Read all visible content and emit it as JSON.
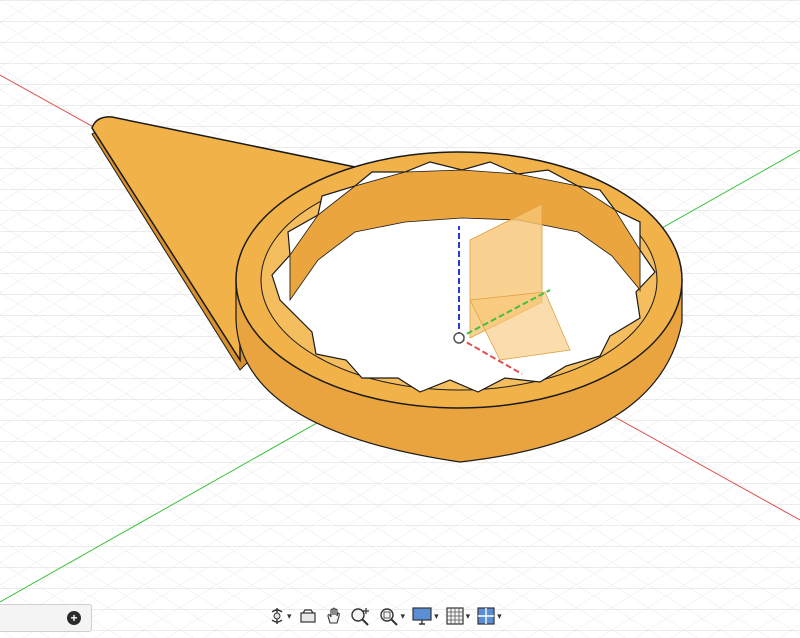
{
  "viewport": {
    "background": "#ffffff",
    "grid_color": "#d9d9d9",
    "model_color": "#f2b24a",
    "model_shadow_color": "#d8902c",
    "axis_x_color": "#e05050",
    "axis_y_color": "#3ec23e",
    "axis_z_color": "#2a3ccf"
  },
  "browser_panel": {
    "expand_icon": "plus-circle-icon"
  },
  "navigation_toolbar": {
    "tools": [
      {
        "id": "orbit",
        "icon": "orbit-icon",
        "has_dropdown": true
      },
      {
        "id": "look-at",
        "icon": "look-at-icon",
        "has_dropdown": false
      },
      {
        "id": "pan",
        "icon": "hand-pan-icon",
        "has_dropdown": false
      },
      {
        "id": "zoom",
        "icon": "zoom-icon",
        "has_dropdown": false
      },
      {
        "id": "fit",
        "icon": "zoom-window-icon",
        "has_dropdown": true
      },
      {
        "id": "display-settings",
        "icon": "monitor-icon",
        "has_dropdown": true
      },
      {
        "id": "grid-snaps",
        "icon": "grid-icon",
        "has_dropdown": true
      },
      {
        "id": "viewports",
        "icon": "viewports-icon",
        "has_dropdown": true
      }
    ]
  }
}
